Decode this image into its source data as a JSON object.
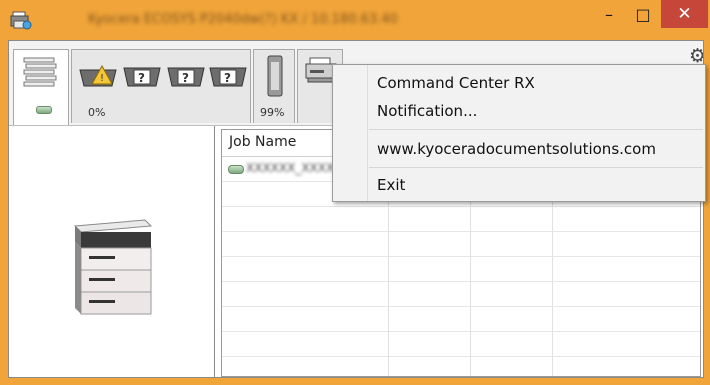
{
  "window": {
    "title": "Kyocera ECOSYS P2040dw(?) KX / 10.180.63.40",
    "minimize_glyph": "–",
    "maximize_glyph": "□",
    "close_glyph": "✕"
  },
  "toolbar": {
    "toner_level": "0%",
    "paper_level": "99%",
    "icons": [
      "printer-status-icon",
      "toner-warning-icon",
      "toner-unknown-icon",
      "paper-tray-icon",
      "scanner-icon",
      "gear-icon"
    ]
  },
  "job_list": {
    "column_header": "Job Name",
    "rows": [
      {
        "job_name": "XXXXXX_XXXX"
      }
    ]
  },
  "context_menu": {
    "items": [
      "Command Center RX",
      "Notification...",
      "www.kyoceradocumentsolutions.com",
      "Exit"
    ]
  },
  "colors": {
    "title_bar": "#f0a43a",
    "close_button": "#c7463a",
    "window_bg": "#ffffff",
    "menu_bg": "#f2f2f2"
  }
}
